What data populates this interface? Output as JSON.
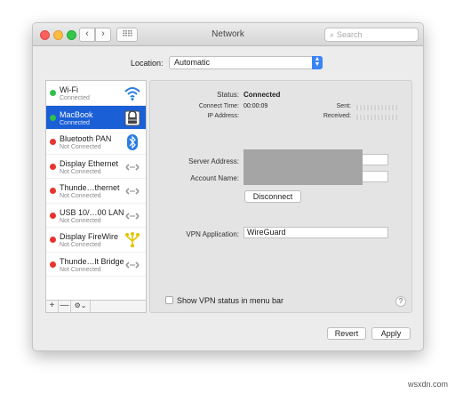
{
  "window": {
    "title": "Network"
  },
  "search": {
    "placeholder": "Search"
  },
  "location": {
    "label": "Location:",
    "value": "Automatic"
  },
  "services": [
    {
      "name": "Wi-Fi",
      "status": "Connected",
      "dot": "green",
      "icon": "wifi-icon"
    },
    {
      "name": "MacBook",
      "status": "Connected",
      "dot": "green",
      "icon": "vpn-lock-icon",
      "selected": true
    },
    {
      "name": "Bluetooth PAN",
      "status": "Not Connected",
      "dot": "red",
      "icon": "bluetooth-icon"
    },
    {
      "name": "Display Ethernet",
      "status": "Not Connected",
      "dot": "red",
      "icon": "ethernet-icon"
    },
    {
      "name": "Thunde…thernet",
      "status": "Not Connected",
      "dot": "red",
      "icon": "ethernet-icon"
    },
    {
      "name": "USB 10/…00 LAN",
      "status": "Not Connected",
      "dot": "red",
      "icon": "ethernet-icon"
    },
    {
      "name": "Display FireWire",
      "status": "Not Connected",
      "dot": "red",
      "icon": "firewire-icon"
    },
    {
      "name": "Thunde…lt Bridge",
      "status": "Not Connected",
      "dot": "red",
      "icon": "ethernet-icon"
    }
  ],
  "sidebar_footer": {
    "add": "+",
    "remove": "—",
    "gear": "⚙⌄"
  },
  "detail": {
    "status_label": "Status:",
    "status_value": "Connected",
    "connect_time_label": "Connect Time:",
    "connect_time_value": "00:00:09",
    "ip_label": "IP Address:",
    "sent_label": "Sent:",
    "received_label": "Received:",
    "server_label": "Server Address:",
    "account_label": "Account Name:",
    "disconnect": "Disconnect",
    "vpn_app_label": "VPN Application:",
    "vpn_app_value": "WireGuard",
    "show_status_label": "Show VPN status in menu bar",
    "help": "?"
  },
  "buttons": {
    "revert": "Revert",
    "apply": "Apply"
  },
  "watermark": "wsxdn.com",
  "colors": {
    "selection": "#1a5fd6",
    "connected": "#2fc14a",
    "not_connected": "#e8332e",
    "accent": "#3a84f5"
  }
}
